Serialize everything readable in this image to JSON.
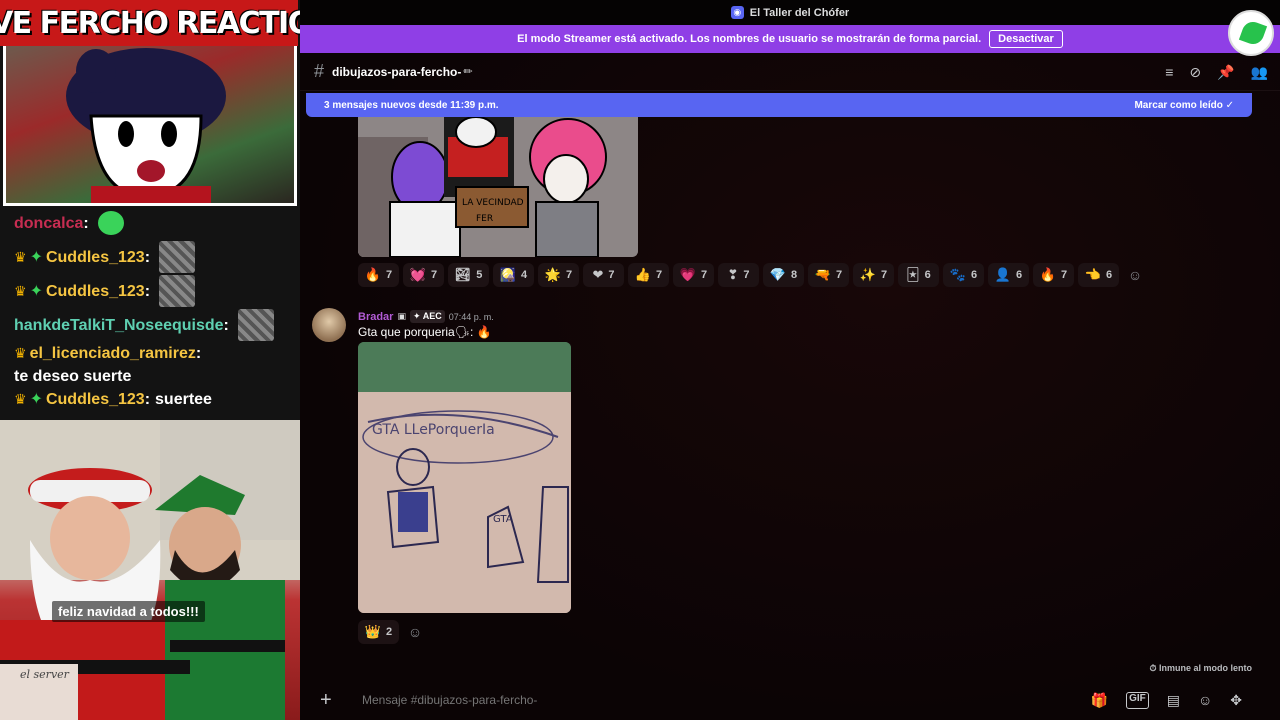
{
  "stream": {
    "title": "LIVE FERCHO REACTION",
    "chat": [
      {
        "user": "doncalca",
        "sep": ":",
        "text": "",
        "emote": true,
        "color": "red",
        "crown": false,
        "gem": false
      },
      {
        "user": "Cuddles_123",
        "sep": ":",
        "text": "",
        "emote": true,
        "color": "gold",
        "crown": true,
        "gem": true
      },
      {
        "user": "Cuddles_123",
        "sep": ":",
        "text": "",
        "emote": true,
        "color": "gold",
        "crown": true,
        "gem": true
      },
      {
        "user": "hankdeTalkiT_Noseequisde",
        "sep": ":",
        "text": "",
        "emote": true,
        "color": "teal",
        "crown": false,
        "gem": false
      },
      {
        "user": "el_licenciado_ramirez",
        "sep": ":",
        "text": "te deseo suerte",
        "emote": false,
        "color": "gold",
        "crown": true,
        "gem": false
      },
      {
        "user": "Cuddles_123",
        "sep": ":",
        "text": "suertee",
        "emote": false,
        "color": "gold",
        "crown": true,
        "gem": true
      }
    ],
    "subtitle": "feliz navidad a todos!!!",
    "cam_tag": "el server"
  },
  "discord": {
    "window_title": "El Taller del Chófer",
    "streamer_banner": "El modo Streamer está activado. Los nombres de usuario se mostrarán de forma parcial.",
    "streamer_button": "Desactivar",
    "channel_name": "dibujazos-para-fercho-",
    "new_messages_text": "3 mensajes nuevos desde 11:39 p.m.",
    "mark_read": "Marcar como leído",
    "reactions_msg1": [
      {
        "emoji": "🔥",
        "count": "7"
      },
      {
        "emoji": "💓",
        "count": "7"
      },
      {
        "emoji": "🏞",
        "count": "5"
      },
      {
        "emoji": "🎑",
        "count": "4"
      },
      {
        "emoji": "🌟",
        "count": "7"
      },
      {
        "emoji": "❤",
        "count": "7"
      },
      {
        "emoji": "👍",
        "count": "7"
      },
      {
        "emoji": "💗",
        "count": "7"
      },
      {
        "emoji": "❣",
        "count": "7"
      },
      {
        "emoji": "💎",
        "count": "8"
      },
      {
        "emoji": "🔫",
        "count": "7"
      },
      {
        "emoji": "✨",
        "count": "7"
      },
      {
        "emoji": "🃏",
        "count": "6"
      },
      {
        "emoji": "🐾",
        "count": "6"
      },
      {
        "emoji": "👤",
        "count": "6"
      },
      {
        "emoji": "🔥",
        "count": "7"
      },
      {
        "emoji": "👈",
        "count": "6"
      }
    ],
    "msg2": {
      "author": "Bradar",
      "tag": "AEC",
      "time": "07:44 p. m.",
      "text": "Gta que porqueria"
    },
    "reactions_msg2": [
      {
        "emoji": "👑",
        "count": "2"
      }
    ],
    "slowmode": "Inmune al modo lento",
    "composer_placeholder": "Mensaje #dibujazos-para-fercho-"
  }
}
